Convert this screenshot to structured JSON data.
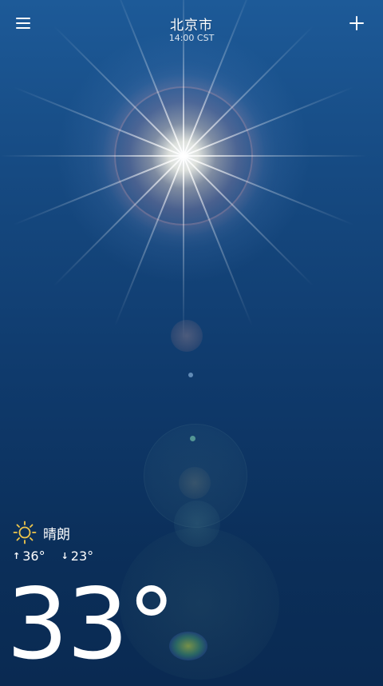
{
  "header": {
    "city": "北京市",
    "time": "14:00 CST",
    "menu_icon": "hamburger-menu-icon",
    "add_icon": "plus-icon"
  },
  "current": {
    "condition_icon": "sun-icon",
    "condition": "晴朗",
    "high_icon": "arrow-up-icon",
    "high": "36°",
    "low_icon": "arrow-down-icon",
    "low": "23°",
    "temperature": "33°"
  },
  "colors": {
    "sun_icon": "#f2c84b",
    "text": "#ffffff",
    "sky_top": "#1d5a98",
    "sky_bottom": "#0a2a52"
  }
}
